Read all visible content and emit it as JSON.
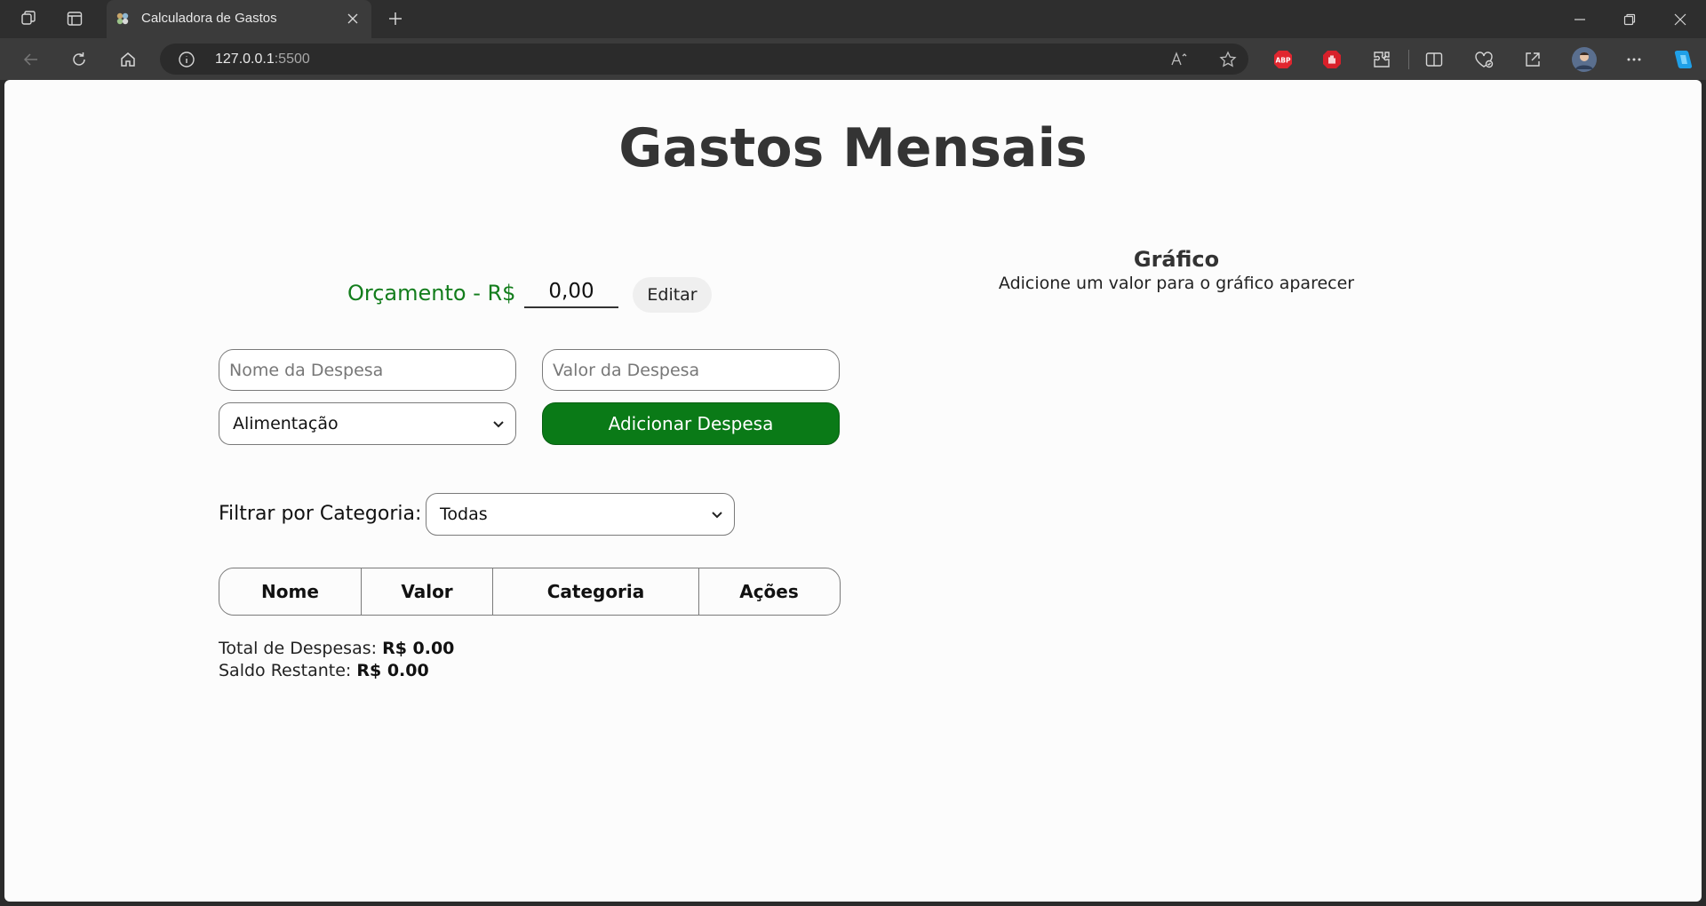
{
  "browser": {
    "tab_title": "Calculadora de Gastos",
    "url_host": "127.0.0.1",
    "url_port": ":5500",
    "avatar_color": "#5a6f8f"
  },
  "page": {
    "title": "Gastos Mensais",
    "budget": {
      "label": "Orçamento - R$",
      "value": "0,00",
      "edit_label": "Editar"
    },
    "form": {
      "name_placeholder": "Nome da Despesa",
      "value_placeholder": "Valor da Despesa",
      "category_selected": "Alimentação",
      "add_label": "Adicionar Despesa"
    },
    "filter": {
      "label": "Filtrar por Categoria:",
      "selected": "Todas"
    },
    "table": {
      "headers": [
        "Nome",
        "Valor",
        "Categoria",
        "Ações"
      ]
    },
    "totals": {
      "total_label": "Total de Despesas:",
      "total_value": "R$ 0.00",
      "balance_label": "Saldo Restante:",
      "balance_value": "R$ 0.00"
    },
    "chart": {
      "title": "Gráfico",
      "subtitle": "Adicione um valor para o gráfico aparecer"
    }
  },
  "colors": {
    "accent_green": "#0a7a17",
    "budget_green": "#137d1c"
  }
}
